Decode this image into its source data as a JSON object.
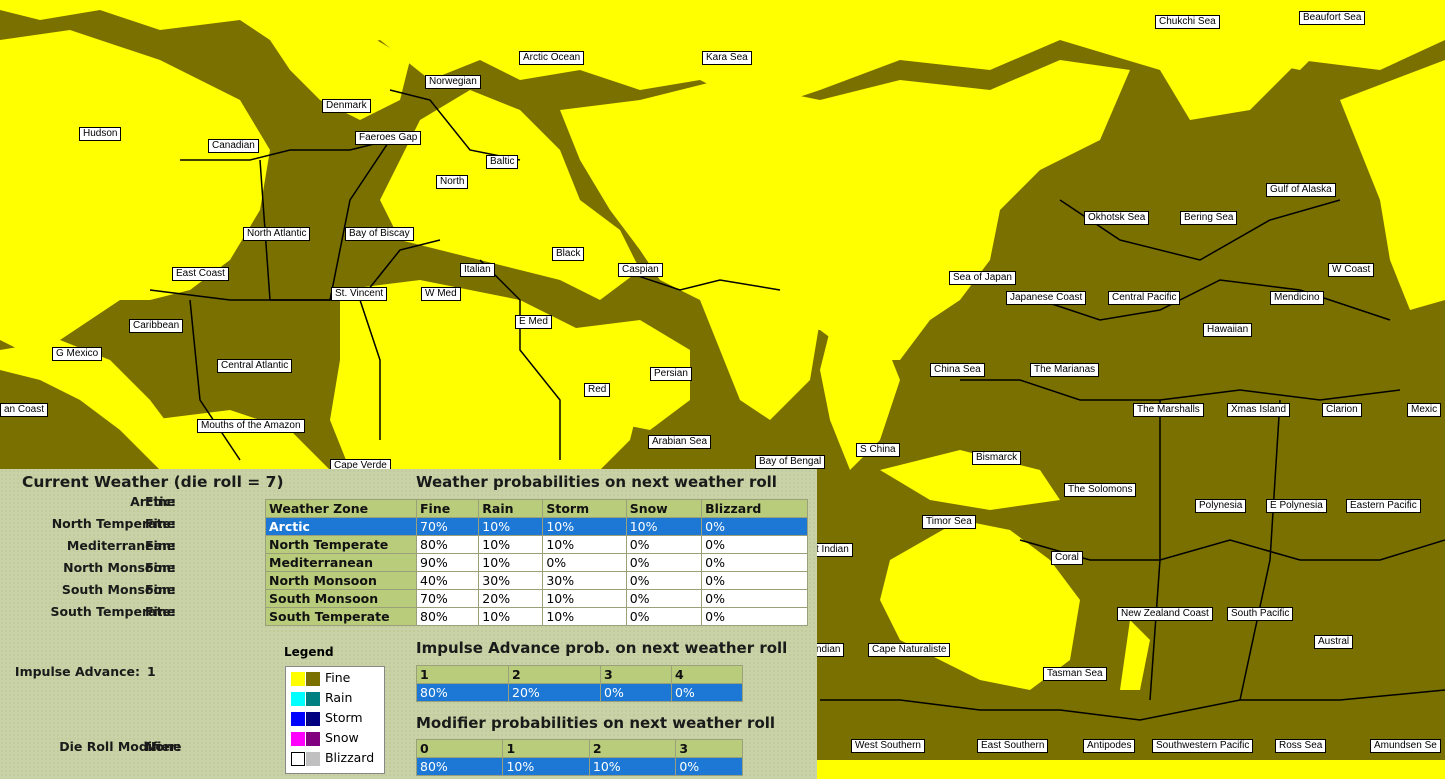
{
  "colors": {
    "fine_land": "#ffff00",
    "fine_sea": "#7a7000",
    "rain_a": "#00ffff",
    "rain_b": "#008080",
    "storm_a": "#0000ff",
    "storm_b": "#000080",
    "snow_a": "#ff00ff",
    "snow_b": "#800080",
    "blizzard_a": "#ffffff",
    "blizzard_b": "#c0c0c0",
    "header": "#b9cc7b",
    "selected": "#1c78d4"
  },
  "map_labels": [
    "Chukchi Sea",
    "Beaufort Sea",
    "Arctic Ocean",
    "Kara Sea",
    "Norwegian",
    "Denmark",
    "Hudson",
    "Canadian",
    "Faeroes Gap",
    "Baltic",
    "North",
    "Gulf of Alaska",
    "Okhotsk Sea",
    "Bering Sea",
    "North Atlantic",
    "Bay of Biscay",
    "Black",
    "Italian",
    "Caspian",
    "Sea of Japan",
    "W Coast",
    "East Coast",
    "St. Vincent",
    "W Med",
    "Japanese Coast",
    "Central Pacific",
    "Mendicino",
    "Caribbean",
    "E Med",
    "Hawaiian",
    "G Mexico",
    "Central Atlantic",
    "Persian",
    "China Sea",
    "The Marianas",
    "Red",
    "an Coast",
    "The Marshalls",
    "Xmas Island",
    "Clarion",
    "Mexic",
    "Mouths of the Amazon",
    "Arabian Sea",
    "S China",
    "Bismarck",
    "Cape Verde",
    "Bay of Bengal",
    "The Solomons",
    "Polynesia",
    "E Polynesia",
    "Eastern Pacific",
    "Timor Sea",
    "t Indian",
    "Coral",
    "New Zealand Coast",
    "South Pacific",
    "Austral",
    "ndian",
    "Cape Naturaliste",
    "Tasman Sea",
    "West Southern",
    "East Southern",
    "Antipodes",
    "Southwestern Pacific",
    "Ross Sea",
    "Amundsen Se"
  ],
  "current": {
    "title": "Current Weather (die roll = 7)",
    "zones": [
      {
        "name": "Arctic:",
        "value": "Fine"
      },
      {
        "name": "North Temperate:",
        "value": "Fine"
      },
      {
        "name": "Mediterranean:",
        "value": "Fine"
      },
      {
        "name": "North Monsoon:",
        "value": "Fine"
      },
      {
        "name": "South Monsoon:",
        "value": "Fine"
      },
      {
        "name": "South Temperate:",
        "value": "Fine"
      }
    ],
    "impulse_label": "Impulse Advance:",
    "impulse_value": "1",
    "modifier_label": "Die Roll Modifier:",
    "modifier_value": "None"
  },
  "probs": {
    "title": "Weather probabilities on next weather roll",
    "headers": [
      "Weather Zone",
      "Fine",
      "Rain",
      "Storm",
      "Snow",
      "Blizzard"
    ],
    "rows": [
      [
        "Arctic",
        "70%",
        "10%",
        "10%",
        "10%",
        "0%"
      ],
      [
        "North Temperate",
        "80%",
        "10%",
        "10%",
        "0%",
        "0%"
      ],
      [
        "Mediterranean",
        "90%",
        "10%",
        "0%",
        "0%",
        "0%"
      ],
      [
        "North Monsoon",
        "40%",
        "30%",
        "30%",
        "0%",
        "0%"
      ],
      [
        "South Monsoon",
        "70%",
        "20%",
        "10%",
        "0%",
        "0%"
      ],
      [
        "South Temperate",
        "80%",
        "10%",
        "10%",
        "0%",
        "0%"
      ]
    ]
  },
  "impulse": {
    "title": "Impulse Advance prob. on next weather roll",
    "headers": [
      "1",
      "2",
      "3",
      "4"
    ],
    "values": [
      "80%",
      "20%",
      "0%",
      "0%"
    ]
  },
  "modifier": {
    "title": "Modifier probabilities on next weather roll",
    "headers": [
      "0",
      "1",
      "2",
      "3"
    ],
    "values": [
      "80%",
      "10%",
      "10%",
      "0%"
    ]
  },
  "legend": {
    "title": "Legend",
    "items": [
      "Fine",
      "Rain",
      "Storm",
      "Snow",
      "Blizzard"
    ]
  }
}
